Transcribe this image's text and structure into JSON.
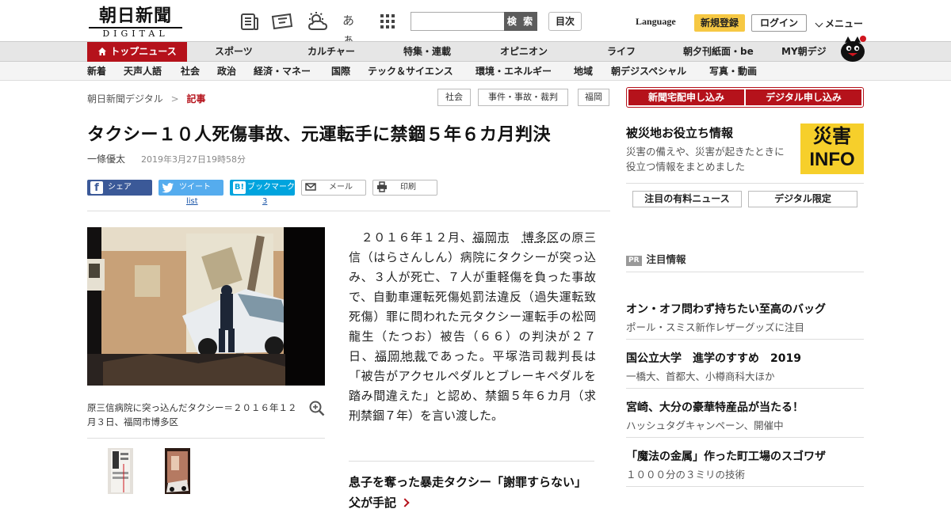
{
  "header": {
    "logo_top": "朝日新聞",
    "logo_bottom": "DIGITAL",
    "search_button": "検 索",
    "search_placeholder": "",
    "toc_button": "目次",
    "language": "Language",
    "register": "新規登録",
    "login": "ログイン",
    "menu": "メニュー",
    "icons": [
      "newspaper-icon",
      "ticket-icon",
      "weather-icon",
      "font-size-icon",
      "grid-apps-icon"
    ],
    "font_size_glyph": "あぁ"
  },
  "nav_primary": [
    {
      "label": "トップニュース",
      "active": true
    },
    {
      "label": "スポーツ"
    },
    {
      "label": "カルチャー"
    },
    {
      "label": "特集・連載"
    },
    {
      "label": "オピニオン"
    },
    {
      "label": "ライフ"
    },
    {
      "label": "朝夕刊紙面・be"
    },
    {
      "label": "MY朝デジ"
    }
  ],
  "nav_secondary": [
    "新着",
    "天声人語",
    "社会",
    "政治",
    "経済・マネー",
    "国際",
    "テック＆サイエンス",
    "環境・エネルギー",
    "地域",
    "朝デジスペシャル",
    "写真・動画"
  ],
  "breadcrumb": {
    "home": "朝日新聞デジタル",
    "sep": ">",
    "current": "記事"
  },
  "tags": [
    "社会",
    "事件・事故・裁判",
    "福岡"
  ],
  "article": {
    "title": "タクシー１０人死傷事故、元運転手に禁錮５年６カ月判決",
    "author": "一條優太",
    "date": "2019年3月27日19時58分",
    "share": {
      "facebook": "シェア",
      "twitter": "ツイート",
      "hatena": "ブックマーク",
      "hatena_logo": "B!",
      "mail": "メール",
      "print": "印刷",
      "twitter_count": "list",
      "hatena_count": "3"
    },
    "caption": "原三信病院に突っ込んだタクシー＝２０１６年１２月３日、福岡市博多区",
    "body_parts": {
      "p1": "　２０１６年１２月、",
      "link1": "福岡市",
      "p1b": "",
      "link2": "博多区",
      "p2": "の原三信（はらさんしん）病院にタクシーが突っ込み、３人が死亡、７人が重軽傷を負った事故で、自動車運転死傷処罰法違反（過失運転致死傷）罪に問われた元タクシー運転手の松岡龍生（たつお）被告（６６）の判決が２７日、",
      "link3": "福岡地裁",
      "p3": "であった。平塚浩司裁判長は「被告がアクセルペダルとブレーキペダルを踏み間違えた」と認め、禁錮５年６カ月（求刑禁錮７年）を言い渡した。"
    },
    "related": "息子を奪った暴走タクシー「謝罪すらない」 父が手記"
  },
  "sidebar": {
    "apply_paper": "新聞宅配申し込み",
    "apply_digital": "デジタル申し込み",
    "disaster_title": "被災地お役立ち情報",
    "disaster_text": "災害の備えや、災害が起きたときに役立つ情報をまとめました",
    "info_top": "災害",
    "info_bottom": "INFO",
    "btn_paid": "注目の有料ニュース",
    "btn_digital": "デジタル限定",
    "pr_badge": "PR",
    "pr_title": "注目情報",
    "ads": [
      {
        "title": "オン・オフ問わず持ちたい至高のバッグ",
        "sub": "ポール・スミス新作レザーグッズに注目"
      },
      {
        "title": "国公立大学　進学のすすめ　2019",
        "sub": "一橋大、首都大、小樽商科大ほか"
      },
      {
        "title": "宮崎、大分の豪華特産品が当たる！",
        "sub": "ハッシュタグキャンペーン、開催中"
      },
      {
        "title": "「魔法の金属」作った町工場のスゴワザ",
        "sub": "１０００分の３ミリの技術"
      }
    ]
  },
  "colors": {
    "accent": "#b5121b",
    "register": "#f6c843",
    "info_bg": "#f6cf2b",
    "facebook": "#3b5998",
    "twitter": "#55acee",
    "hatena": "#00a4de"
  }
}
